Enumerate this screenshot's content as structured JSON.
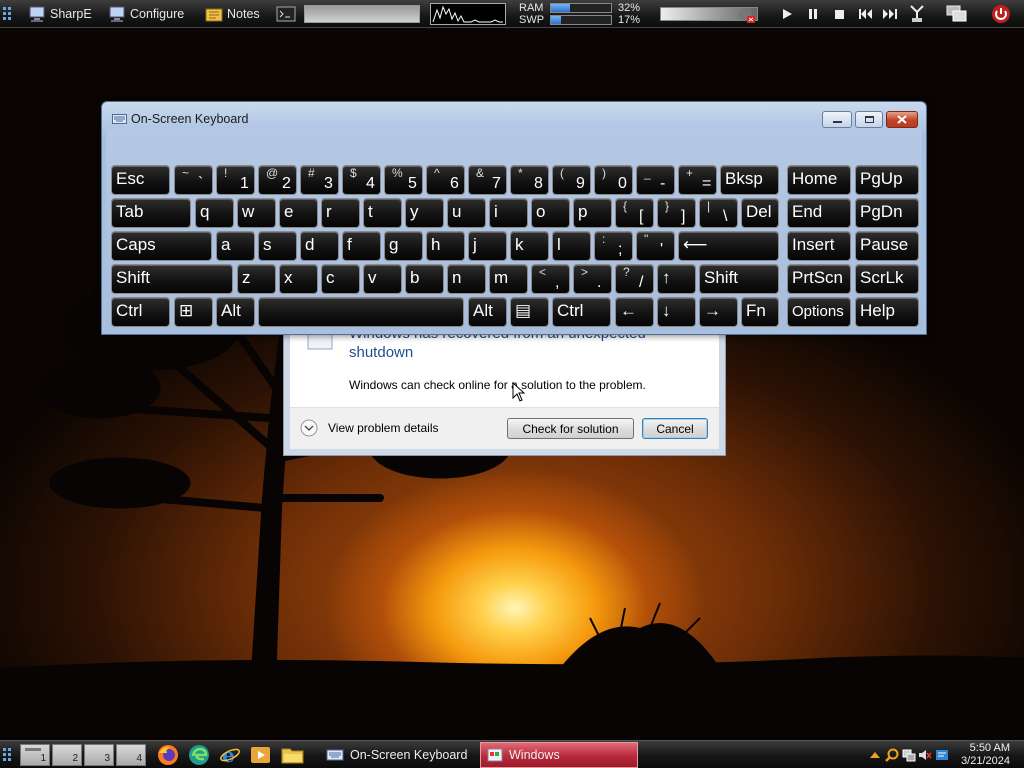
{
  "topbar": {
    "apps": [
      {
        "label": "SharpE",
        "icon": "computer-icon"
      },
      {
        "label": "Configure",
        "icon": "computer-icon"
      },
      {
        "label": "Notes",
        "icon": "notes-icon"
      }
    ],
    "ram_label": "RAM",
    "swp_label": "SWP",
    "ram_pct": "32%",
    "swp_pct": "17%",
    "ram_fraction": 0.32,
    "swp_fraction": 0.17,
    "media": [
      "play-icon",
      "pause-icon",
      "stop-icon",
      "previous-icon",
      "next-icon"
    ],
    "power_icon": "power-icon"
  },
  "error_dialog": {
    "title_partial": "Windows has recovered from an unexpected",
    "title_line2": "shutdown",
    "message": "Windows can check online for a solution to the problem.",
    "details_label": "View problem details",
    "check_button": "Check for solution",
    "cancel_button": "Cancel"
  },
  "osk": {
    "title": "On-Screen Keyboard",
    "rows": [
      [
        {
          "k": "Esc"
        },
        {
          "s": "~",
          "l": "`"
        },
        {
          "s": "!",
          "l": "1"
        },
        {
          "s": "@",
          "l": "2"
        },
        {
          "s": "#",
          "l": "3"
        },
        {
          "s": "$",
          "l": "4"
        },
        {
          "s": "%",
          "l": "5"
        },
        {
          "s": "^",
          "l": "6"
        },
        {
          "s": "&",
          "l": "7"
        },
        {
          "s": "*",
          "l": "8"
        },
        {
          "s": "(",
          "l": "9"
        },
        {
          "s": ")",
          "l": "0"
        },
        {
          "s": "_",
          "l": "-"
        },
        {
          "s": "+",
          "l": "="
        },
        {
          "k": "Bksp"
        },
        {
          "k": "Home"
        },
        {
          "k": "PgUp"
        }
      ],
      [
        {
          "k": "Tab"
        },
        {
          "k": "q"
        },
        {
          "k": "w"
        },
        {
          "k": "e"
        },
        {
          "k": "r"
        },
        {
          "k": "t"
        },
        {
          "k": "y"
        },
        {
          "k": "u"
        },
        {
          "k": "i"
        },
        {
          "k": "o"
        },
        {
          "k": "p"
        },
        {
          "s": "{",
          "l": "["
        },
        {
          "s": "}",
          "l": "]"
        },
        {
          "s": "|",
          "l": "\\"
        },
        {
          "k": "Del"
        },
        {
          "k": "End"
        },
        {
          "k": "PgDn"
        }
      ],
      [
        {
          "k": "Caps"
        },
        {
          "k": "a"
        },
        {
          "k": "s"
        },
        {
          "k": "d"
        },
        {
          "k": "f"
        },
        {
          "k": "g"
        },
        {
          "k": "h"
        },
        {
          "k": "j"
        },
        {
          "k": "k"
        },
        {
          "k": "l"
        },
        {
          "s": ":",
          "l": ";"
        },
        {
          "s": "\"",
          "l": "'"
        },
        {
          "k": "⟵"
        },
        {
          "k": "Insert"
        },
        {
          "k": "Pause"
        }
      ],
      [
        {
          "k": "Shift"
        },
        {
          "k": "z"
        },
        {
          "k": "x"
        },
        {
          "k": "c"
        },
        {
          "k": "v"
        },
        {
          "k": "b"
        },
        {
          "k": "n"
        },
        {
          "k": "m"
        },
        {
          "s": "<",
          "l": ","
        },
        {
          "s": ">",
          "l": "."
        },
        {
          "s": "?",
          "l": "/"
        },
        {
          "k": "↑"
        },
        {
          "k": "Shift"
        },
        {
          "k": "PrtScn"
        },
        {
          "k": "ScrLk"
        }
      ],
      [
        {
          "k": "Ctrl"
        },
        {
          "k": "⊞"
        },
        {
          "k": "Alt"
        },
        {
          "k": ""
        },
        {
          "k": "Alt"
        },
        {
          "k": "▤"
        },
        {
          "k": "Ctrl"
        },
        {
          "k": "←"
        },
        {
          "k": "↓"
        },
        {
          "k": "→"
        },
        {
          "k": "Fn"
        },
        {
          "k": "Options"
        },
        {
          "k": "Help"
        }
      ]
    ]
  },
  "taskbar": {
    "desktops": [
      "1",
      "2",
      "3",
      "4"
    ],
    "quick_launch": [
      "firefox-icon",
      "edge-icon",
      "internet-explorer-icon",
      "media-player-icon",
      "folder-icon"
    ],
    "tasks": [
      {
        "label": "On-Screen Keyboard",
        "icon": "keyboard-icon",
        "active": false
      },
      {
        "label": "Windows",
        "icon": "windows-icon",
        "active": true
      }
    ],
    "time": "5:50 AM",
    "date": "3/21/2024"
  }
}
